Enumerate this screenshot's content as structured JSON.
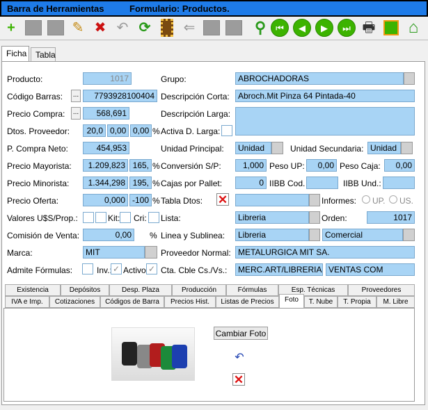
{
  "titlebar": {
    "left": "Barra de Herramientas",
    "right": "Formulario: Productos."
  },
  "toolbar": {
    "icons": [
      "add-icon",
      "save-icon",
      "save-as-icon",
      "edit-icon",
      "delete-save-icon",
      "undo-icon",
      "refresh-icon",
      "film-icon",
      "back-icon",
      "grid-icon",
      "grid2-icon",
      "search-icon",
      "first-icon",
      "prev-icon",
      "next-icon",
      "last-icon",
      "print-icon",
      "gift-icon",
      "home-icon"
    ]
  },
  "tabs": {
    "ficha": "Ficha",
    "tabla": "Tabla"
  },
  "form": {
    "producto_lbl": "Producto:",
    "producto": "1017",
    "grupo_lbl": "Grupo:",
    "grupo": "ABROCHADORAS",
    "codigo_lbl": "Código Barras:",
    "codigo": "7793928100404",
    "desc_corta_lbl": "Descripción Corta:",
    "desc_corta": "Abroch.Mit Pinza 64 Pintada-40",
    "precio_compra_lbl": "Precio Compra:",
    "precio_compra": "568,691",
    "desc_larga_lbl": "Descripción Larga:",
    "dtos_prov_lbl": "Dtos. Proveedor:",
    "dto1": "20,0",
    "dto2": "0,00",
    "dto3": "0,00",
    "pct": "%",
    "activa_lbl": "Activa D. Larga:",
    "pcn_lbl": "P. Compra Neto:",
    "pcn": "454,953",
    "unidad_principal_lbl": "Unidad Principal:",
    "unidad_principal": "Unidad",
    "unidad_sec_lbl": "Unidad Secundaria:",
    "unidad_sec": "Unidad",
    "pmay_lbl": "Precio Mayorista:",
    "pmay": "1.209,823",
    "pmay_pct": "165,",
    "conv_lbl": "Conversión S/P:",
    "conv": "1,000",
    "peso_up_lbl": "Peso UP:",
    "peso_up": "0,00",
    "peso_caja_lbl": "Peso Caja:",
    "peso_caja": "0,00",
    "pmin_lbl": "Precio Minorista:",
    "pmin": "1.344,298",
    "pmin_pct": "195,",
    "cajas_lbl": "Cajas por Pallet:",
    "cajas": "0",
    "iibb_cod_lbl": "IIBB Cod.",
    "iibb_und_lbl": "IIBB Und.:",
    "poferta_lbl": "Precio Oferta:",
    "poferta": "0,000",
    "poferta_pct": "-100",
    "tabla_dtos_lbl": "Tabla Dtos:",
    "informes_lbl": "Informes:",
    "up": "UP.",
    "us": "US.",
    "valores_lbl": "Valores U$S/Prop.:",
    "kit_lbl": "Kit:",
    "cri_lbl": "Cri:",
    "lista_lbl": "Lista:",
    "lista": "Libreria",
    "orden_lbl": "Orden:",
    "orden": "1017",
    "comision_lbl": "Comisión de Venta:",
    "comision": "0,00",
    "linea_lbl": "Linea y Sublinea:",
    "linea": "Libreria",
    "sublinea": "Comercial",
    "marca_lbl": "Marca:",
    "marca": "MIT",
    "prov_lbl": "Proveedor Normal:",
    "prov": "METALURGICA MIT SA.",
    "admite_lbl": "Admite Fórmulas:",
    "inv_lbl": "Inv.:",
    "activo_lbl": "Activo:",
    "cta_lbl": "Cta. Cble Cs./Vs.:",
    "cta1": "MERC.ART/LIBRERIA",
    "cta2": "VENTAS COM"
  },
  "subtabs_row1": [
    "Existencia",
    "Depósitos",
    "Desp. Plaza",
    "Producción",
    "Fórmulas",
    "Esp. Técnicas",
    "Proveedores"
  ],
  "subtabs_row2": [
    "IVA e Imp.",
    "Cotizaciones",
    "Códigos de Barra",
    "Precios Hist.",
    "Listas de Precios",
    "Foto",
    "T. Nube",
    "T. Propia",
    "M. Libre"
  ],
  "foto": {
    "cambiar": "Cambiar Foto"
  },
  "colors": {
    "field": "#a8d4f5",
    "titlebar": "#1e7be8",
    "accent_green": "#3cb300"
  }
}
